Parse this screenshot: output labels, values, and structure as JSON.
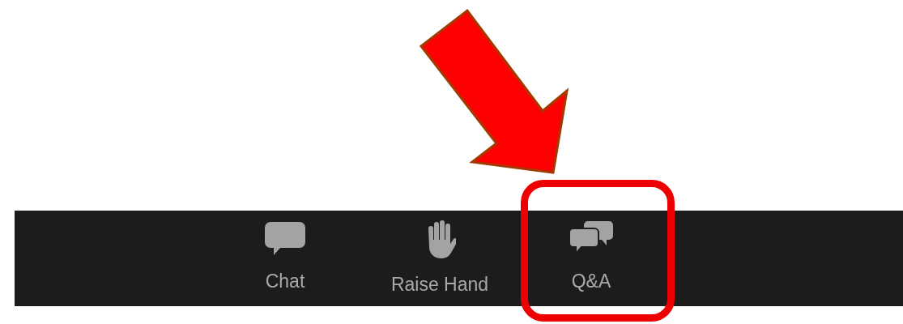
{
  "toolbar": {
    "buttons": [
      {
        "kind": "chat",
        "label": "Chat",
        "highlighted": false
      },
      {
        "kind": "hand",
        "label": "Raise Hand",
        "highlighted": false
      },
      {
        "kind": "qa",
        "label": "Q&A",
        "highlighted": true
      }
    ]
  }
}
